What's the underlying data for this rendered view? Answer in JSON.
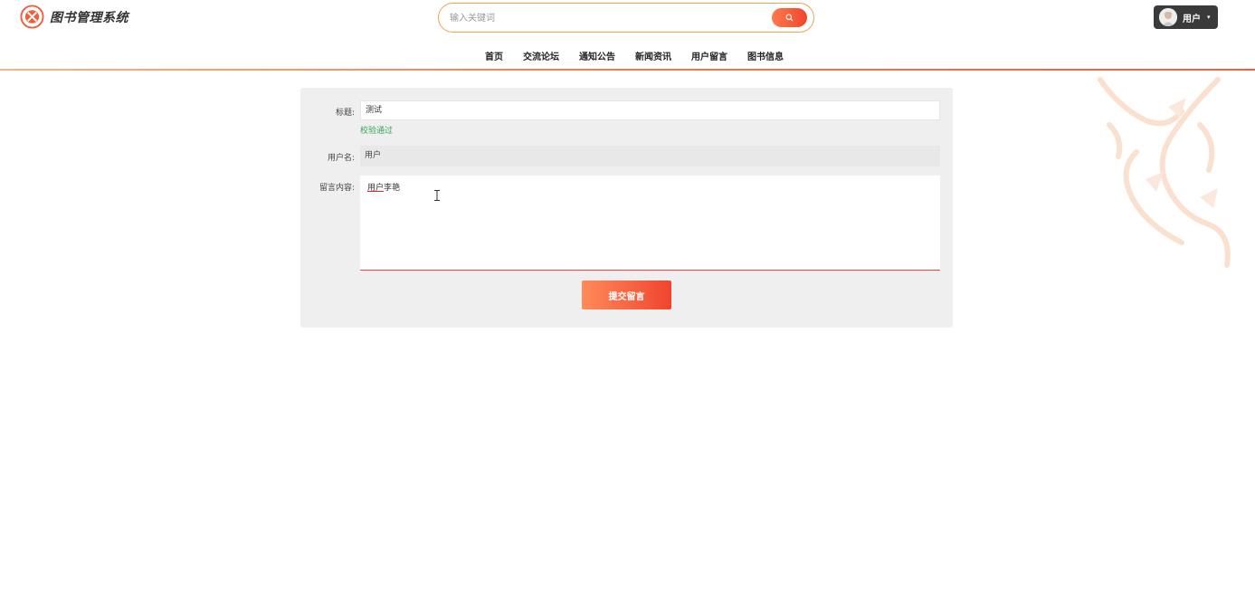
{
  "header": {
    "brand_title": "图书管理系统",
    "search": {
      "placeholder": "输入关键词",
      "value": ""
    },
    "user_menu": {
      "label": "用户"
    }
  },
  "nav": {
    "items": [
      {
        "label": "首页"
      },
      {
        "label": "交流论坛"
      },
      {
        "label": "通知公告"
      },
      {
        "label": "新闻资讯"
      },
      {
        "label": "用户留言"
      },
      {
        "label": "图书信息"
      }
    ]
  },
  "form": {
    "title_label": "标题:",
    "title_value": "测试",
    "validation_message": "校验通过",
    "username_label": "用户名:",
    "username_value": "用户",
    "content_label": "留言内容:",
    "content_underlined": "用户",
    "content_rest": "李艳",
    "submit_label": "提交留言"
  },
  "colors": {
    "accent": "#f0452f",
    "accent_light": "#ff8a5a",
    "valid": "#3aa45a",
    "user_menu_bg": "#3a3a3a"
  },
  "icons": [
    "brand-logo-icon",
    "search-icon",
    "avatar",
    "caret-down-icon",
    "dragon-decoration",
    "text-cursor-icon"
  ]
}
